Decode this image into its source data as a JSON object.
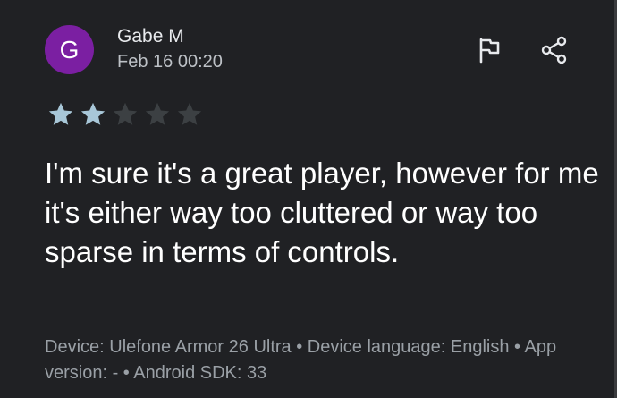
{
  "review": {
    "avatar_letter": "G",
    "author": "Gabe M",
    "date": "Feb 16 00:20",
    "rating": 2,
    "max_rating": 5,
    "text": "I'm sure it's a great player, however for me it's either way too cluttered or way too sparse in terms of controls.",
    "meta": "Device: Ulefone Armor 26 Ultra • Device language: English • App version: - • Android SDK: 33"
  },
  "actions": {
    "flag_icon": "flag-icon",
    "share_icon": "share-icon"
  },
  "colors": {
    "avatar": "#7b1fa2",
    "star_filled": "#a8c7d8",
    "star_empty": "#3c4043",
    "background": "#202124"
  }
}
